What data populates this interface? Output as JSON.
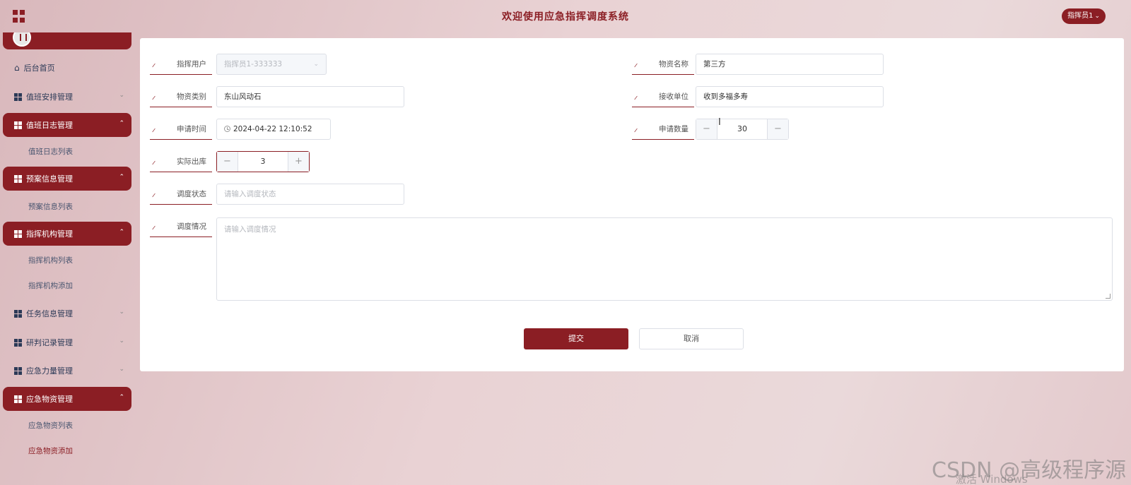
{
  "header": {
    "title": "欢迎使用应急指挥调度系统",
    "user_label": "指挥员1"
  },
  "sidebar": {
    "items": [
      {
        "label": "后台首页"
      },
      {
        "label": "值班安排管理"
      },
      {
        "label": "值班日志管理"
      },
      {
        "label": "值班日志列表"
      },
      {
        "label": "预案信息管理"
      },
      {
        "label": "预案信息列表"
      },
      {
        "label": "指挥机构管理"
      },
      {
        "label": "指挥机构列表"
      },
      {
        "label": "指挥机构添加"
      },
      {
        "label": "任务信息管理"
      },
      {
        "label": "研判记录管理"
      },
      {
        "label": "应急力量管理"
      },
      {
        "label": "应急物资管理"
      },
      {
        "label": "应急物资列表"
      },
      {
        "label": "应急物资添加"
      }
    ]
  },
  "form": {
    "user": {
      "label": "指挥用户",
      "value": "指挥员1-333333"
    },
    "material_name": {
      "label": "物资名称",
      "value": "第三方"
    },
    "category": {
      "label": "物资类别",
      "value": "东山风动石"
    },
    "receiver": {
      "label": "接收单位",
      "value": "收到多福多寿"
    },
    "apply_time": {
      "label": "申请时间",
      "value": "2024-04-22 12:10:52"
    },
    "apply_qty": {
      "label": "申请数量",
      "value": "30"
    },
    "actual_out": {
      "label": "实际出库",
      "value": "3"
    },
    "dispatch_status": {
      "label": "调度状态",
      "placeholder": "请输入调度状态"
    },
    "dispatch_detail": {
      "label": "调度情况",
      "placeholder": "请输入调度情况"
    },
    "submit_label": "提交",
    "cancel_label": "取消"
  },
  "overlay": {
    "watermark": "CSDN @高级程序源",
    "activate": "激活 Windows"
  },
  "colors": {
    "accent": "#8b1e24",
    "nav_text": "#2c3a57"
  }
}
